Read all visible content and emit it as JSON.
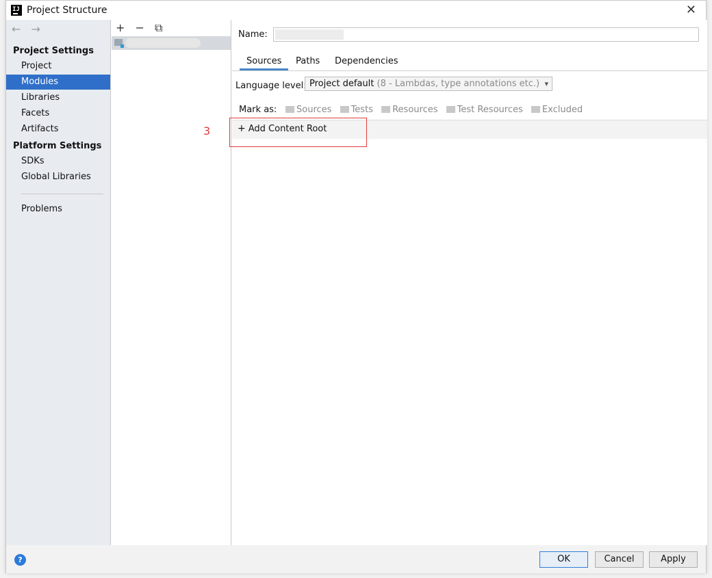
{
  "window": {
    "title": "Project Structure",
    "icon": "intellij-icon"
  },
  "nav": {
    "back": "←",
    "forward": "→"
  },
  "sidebar": {
    "project_settings_heading": "Project Settings",
    "project_items": [
      {
        "label": "Project"
      },
      {
        "label": "Modules",
        "selected": true
      },
      {
        "label": "Libraries"
      },
      {
        "label": "Facets"
      },
      {
        "label": "Artifacts"
      }
    ],
    "platform_settings_heading": "Platform Settings",
    "platform_items": [
      {
        "label": "SDKs"
      },
      {
        "label": "Global Libraries"
      }
    ],
    "problems_label": "Problems"
  },
  "module_toolbar": {
    "add": "+",
    "remove": "−",
    "copy": "⧉"
  },
  "module": {
    "name_label": "Name:",
    "name_value": "",
    "tabs": [
      {
        "label": "Sources",
        "active": true
      },
      {
        "label": "Paths"
      },
      {
        "label": "Dependencies"
      }
    ],
    "language_level_label": "Language level:",
    "language_level_value": "Project default",
    "language_level_hint": "(8 - Lambdas, type annotations etc.)",
    "mark_as_label": "Mark as:",
    "mark_as_items": [
      {
        "label": "Sources"
      },
      {
        "label": "Tests"
      },
      {
        "label": "Resources"
      },
      {
        "label": "Test Resources"
      },
      {
        "label": "Excluded"
      }
    ],
    "add_content_root": "Add Content Root",
    "annotation_number": "3"
  },
  "footer": {
    "help": "?",
    "ok": "OK",
    "cancel": "Cancel",
    "apply": "Apply"
  },
  "colors": {
    "selection": "#2f6fc9",
    "annotation": "#e23a3a",
    "tab_underline": "#4a88c7"
  }
}
